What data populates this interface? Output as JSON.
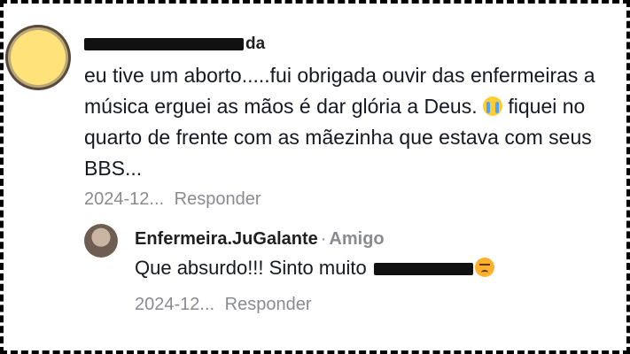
{
  "comment": {
    "username_visible_suffix": "da",
    "text_prefix": "eu tive um aborto.....fui obrigada ouvir das enfermeiras a música erguei as mãos é dar glória a Deus.",
    "emoji_cry": "crying-face-emoji",
    "text_suffix": "fiquei no quarto de frente com as mãezinha que estava com seus BBS...",
    "date": "2024-12...",
    "reply_label": "Responder"
  },
  "reply": {
    "username": "Enfermeira.JuGalante",
    "separator": "·",
    "tag": "Amigo",
    "text_prefix": "Que absurdo!!! Sinto muito",
    "emoji_sad": "disappointed-face-emoji",
    "date": "2024-12...",
    "reply_label": "Responder"
  },
  "colors": {
    "text_primary": "#161823",
    "text_secondary": "#8a8b91",
    "background": "#ffffff",
    "border": "#000000"
  }
}
